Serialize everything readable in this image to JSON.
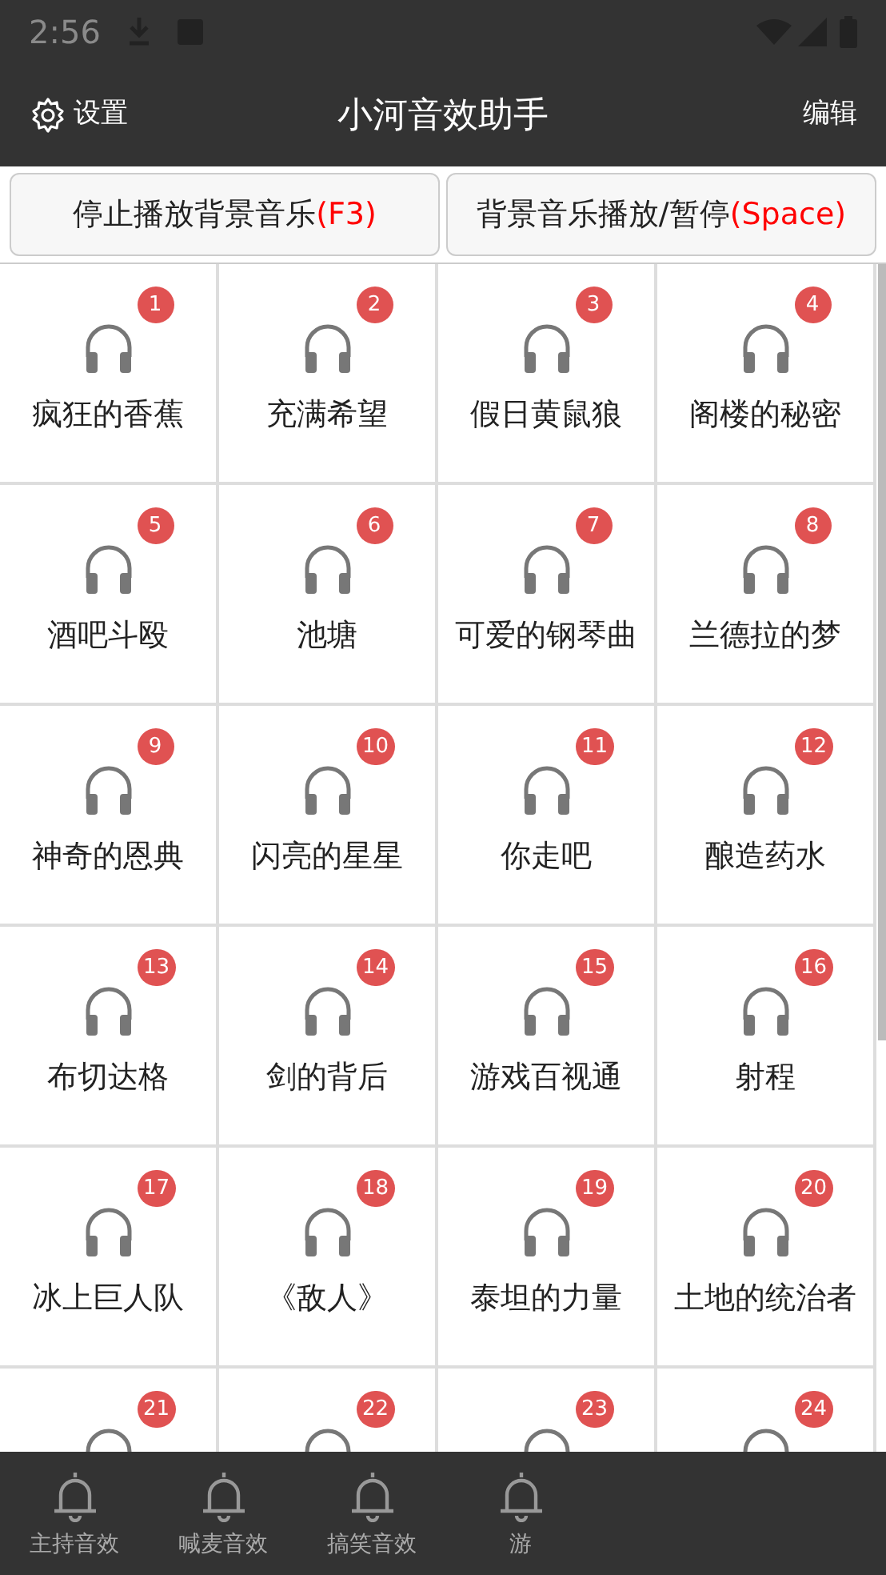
{
  "status_bar": {
    "time": "2:56"
  },
  "header": {
    "left_label": "设置",
    "title": "小河音效助手",
    "right_label": "编辑"
  },
  "controls": [
    {
      "parts": [
        "停止播放背景音乐",
        "(F3)"
      ]
    },
    {
      "parts": [
        "背景音乐播放/暂停",
        "(Space)"
      ]
    }
  ],
  "sounds": [
    {
      "number": "1",
      "name": "疯狂的香蕉"
    },
    {
      "number": "2",
      "name": "充满希望"
    },
    {
      "number": "3",
      "name": "假日黄鼠狼"
    },
    {
      "number": "4",
      "name": "阁楼的秘密"
    },
    {
      "number": "5",
      "name": "酒吧斗殴"
    },
    {
      "number": "6",
      "name": "池塘"
    },
    {
      "number": "7",
      "name": "可爱的钢琴曲"
    },
    {
      "number": "8",
      "name": "兰德拉的梦"
    },
    {
      "number": "9",
      "name": "神奇的恩典"
    },
    {
      "number": "10",
      "name": "闪亮的星星"
    },
    {
      "number": "11",
      "name": "你走吧"
    },
    {
      "number": "12",
      "name": "酿造药水"
    },
    {
      "number": "13",
      "name": "布切达格"
    },
    {
      "number": "14",
      "name": "剑的背后"
    },
    {
      "number": "15",
      "name": "游戏百视通"
    },
    {
      "number": "16",
      "name": "射程"
    },
    {
      "number": "17",
      "name": "冰上巨人队"
    },
    {
      "number": "18",
      "name": "《敌人》"
    },
    {
      "number": "19",
      "name": "泰坦的力量"
    },
    {
      "number": "20",
      "name": "土地的统治者"
    },
    {
      "number": "21"
    },
    {
      "number": "22"
    },
    {
      "number": "23"
    },
    {
      "number": "24"
    }
  ],
  "bottom_tabs": [
    {
      "label": "主持音效"
    },
    {
      "label": "喊麦音效"
    },
    {
      "label": "搞笑音效"
    },
    {
      "label": "游"
    }
  ]
}
